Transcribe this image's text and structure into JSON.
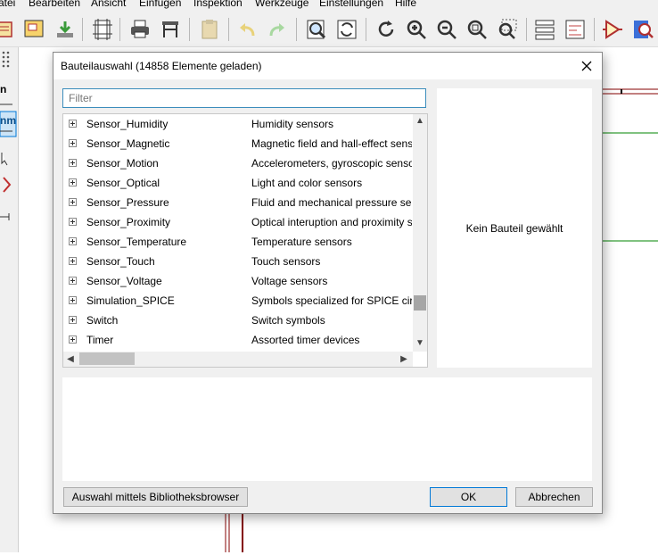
{
  "menubar": {
    "items": [
      "atei",
      "Bearbeiten",
      "Ansicht",
      "Einfügen",
      "Inspektion",
      "Werkzeuge",
      "Einstellungen",
      "Hilfe"
    ]
  },
  "toolbar": {
    "icons": [
      "schematic-setup-icon",
      "sheet-icon",
      "save-icon",
      "page-settings-icon",
      "print-icon",
      "plot-icon",
      "paste-icon",
      "undo-icon",
      "redo-icon",
      "find-icon",
      "find-replace-icon",
      "refresh-icon",
      "zoom-in-icon",
      "zoom-out-icon",
      "zoom-fit-icon",
      "zoom-selection-icon",
      "hierarchy-icon",
      "netlist-icon",
      "symbol-editor-icon",
      "symbol-browser-icon"
    ]
  },
  "left_toolbar": {
    "labels": [
      "n",
      "nm"
    ]
  },
  "dialog": {
    "title": "Bauteilauswahl (14858 Elemente geladen)",
    "filter": {
      "value": "",
      "placeholder": "Filter"
    },
    "rows": [
      {
        "name": "Sensor_Humidity",
        "desc": "Humidity sensors"
      },
      {
        "name": "Sensor_Magnetic",
        "desc": "Magnetic field and hall-effect sensors"
      },
      {
        "name": "Sensor_Motion",
        "desc": "Accelerometers, gyroscopic sensors"
      },
      {
        "name": "Sensor_Optical",
        "desc": "Light and color sensors"
      },
      {
        "name": "Sensor_Pressure",
        "desc": "Fluid and mechanical pressure sensors"
      },
      {
        "name": "Sensor_Proximity",
        "desc": "Optical interuption and proximity sensors"
      },
      {
        "name": "Sensor_Temperature",
        "desc": "Temperature sensors"
      },
      {
        "name": "Sensor_Touch",
        "desc": "Touch sensors"
      },
      {
        "name": "Sensor_Voltage",
        "desc": "Voltage sensors"
      },
      {
        "name": "Simulation_SPICE",
        "desc": "Symbols specialized for SPICE circuits"
      },
      {
        "name": "Switch",
        "desc": "Switch symbols"
      },
      {
        "name": "Timer",
        "desc": "Assorted timer devices"
      }
    ],
    "vertical_scroll": 0.86,
    "preview_text": "Kein Bauteil gewählt",
    "buttons": {
      "library_browser": "Auswahl mittels Bibliotheksbrowser",
      "ok": "OK",
      "cancel": "Abbrechen"
    }
  },
  "colors": {
    "accent": "#0078d7",
    "filter_border": "#3c8dbc",
    "wire_green": "#008400",
    "wire_red": "#840000"
  }
}
